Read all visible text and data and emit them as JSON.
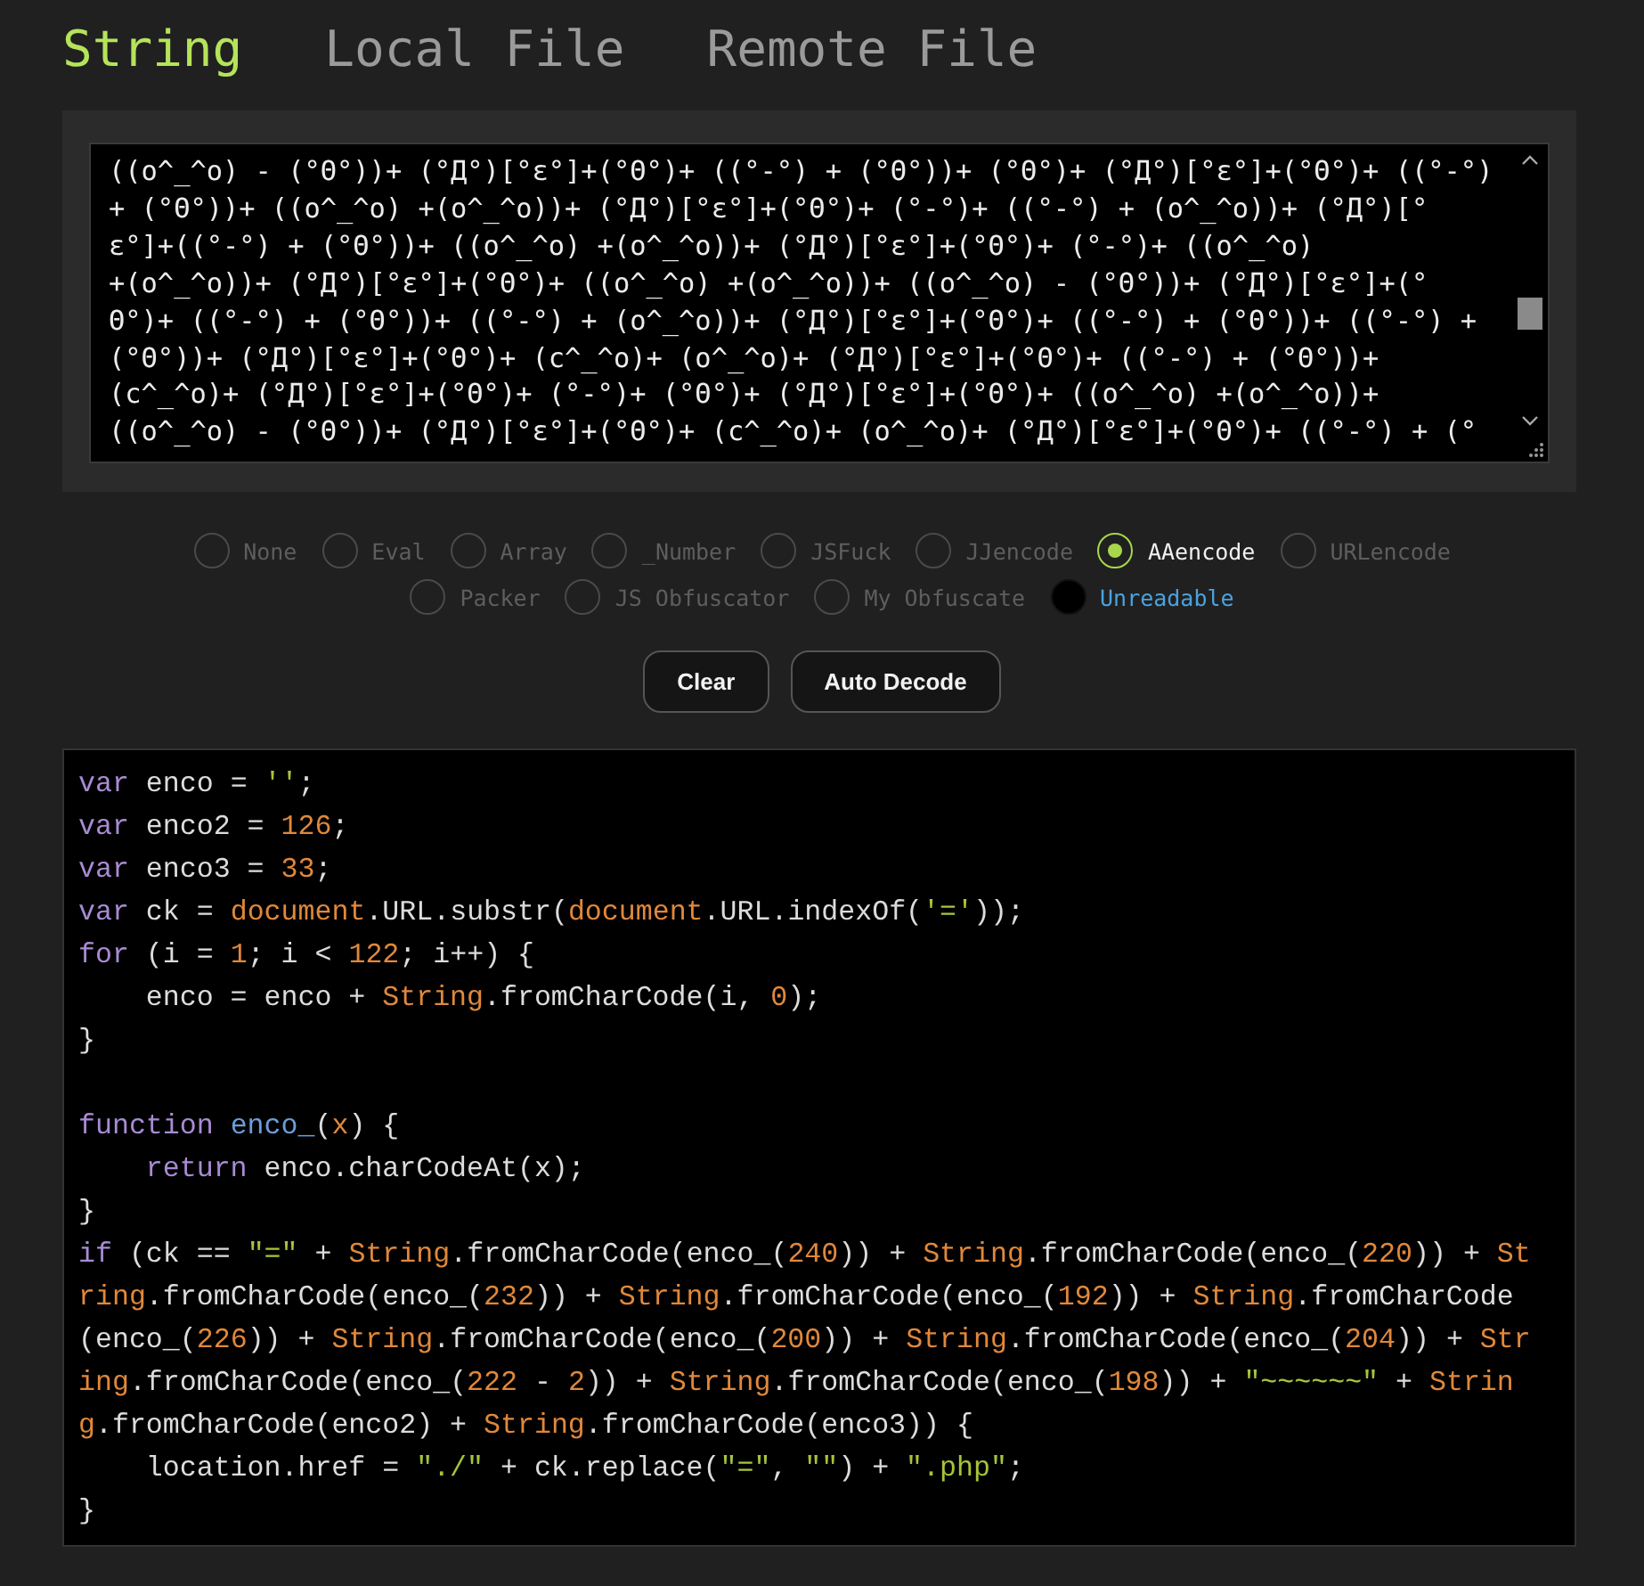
{
  "tabs": [
    {
      "label": "String",
      "selected": true
    },
    {
      "label": "Local File",
      "selected": false
    },
    {
      "label": "Remote File",
      "selected": false
    }
  ],
  "input": {
    "lines": [
      "((o^_^o) - (°Θ°))+ (°Д°)[°ε°]+(°Θ°)+ ((°-°) + (°Θ°))+ (°Θ°)+ (°Д°)[°ε°]+(°Θ°)+ ((°-°)",
      "+ (°Θ°))+ ((o^_^o) +(o^_^o))+ (°Д°)[°ε°]+(°Θ°)+ (°-°)+ ((°-°) + (o^_^o))+ (°Д°)[°",
      "ε°]+((°-°) + (°Θ°))+ ((o^_^o) +(o^_^o))+ (°Д°)[°ε°]+(°Θ°)+ (°-°)+ ((o^_^o)",
      "+(o^_^o))+ (°Д°)[°ε°]+(°Θ°)+ ((o^_^o) +(o^_^o))+ ((o^_^o) - (°Θ°))+ (°Д°)[°ε°]+(°",
      "Θ°)+ ((°-°) + (°Θ°))+ ((°-°) + (o^_^o))+ (°Д°)[°ε°]+(°Θ°)+ ((°-°) + (°Θ°))+ ((°-°) +",
      "(°Θ°))+ (°Д°)[°ε°]+(°Θ°)+ (c^_^o)+ (o^_^o)+ (°Д°)[°ε°]+(°Θ°)+ ((°-°) + (°Θ°))+",
      "(c^_^o)+ (°Д°)[°ε°]+(°Θ°)+ (°-°)+ (°Θ°)+ (°Д°)[°ε°]+(°Θ°)+ ((o^_^o) +(o^_^o))+",
      "((o^_^o) - (°Θ°))+ (°Д°)[°ε°]+(°Θ°)+ (c^_^o)+ (o^_^o)+ (°Д°)[°ε°]+(°Θ°)+ ((°-°) + (°"
    ]
  },
  "options": [
    [
      {
        "label": "None",
        "selected": false,
        "highlighted": false
      },
      {
        "label": "Eval",
        "selected": false,
        "highlighted": false
      },
      {
        "label": "Array",
        "selected": false,
        "highlighted": false
      },
      {
        "label": "_Number",
        "selected": false,
        "highlighted": false
      },
      {
        "label": "JSFuck",
        "selected": false,
        "highlighted": false
      },
      {
        "label": "JJencode",
        "selected": false,
        "highlighted": false
      },
      {
        "label": "AAencode",
        "selected": true,
        "highlighted": false
      },
      {
        "label": "URLencode",
        "selected": false,
        "highlighted": false
      }
    ],
    [
      {
        "label": "Packer",
        "selected": false,
        "highlighted": false
      },
      {
        "label": "JS Obfuscator",
        "selected": false,
        "highlighted": false
      },
      {
        "label": "My Obfuscate",
        "selected": false,
        "highlighted": false
      },
      {
        "label": "Unreadable",
        "selected": false,
        "highlighted": true
      }
    ]
  ],
  "buttons": [
    "Clear",
    "Auto Decode"
  ],
  "code": [
    {
      "kind": "code",
      "indented": false,
      "tokens": [
        {
          "kind": "kw",
          "text": "var"
        },
        {
          "kind": "p",
          "text": " enco = "
        },
        {
          "kind": "str",
          "text": "''"
        },
        {
          "kind": "p",
          "text": ";"
        }
      ]
    },
    {
      "kind": "code",
      "indented": false,
      "tokens": [
        {
          "kind": "kw",
          "text": "var"
        },
        {
          "kind": "p",
          "text": " enco2 = "
        },
        {
          "kind": "num",
          "text": "126"
        },
        {
          "kind": "p",
          "text": ";"
        }
      ]
    },
    {
      "kind": "code",
      "indented": false,
      "tokens": [
        {
          "kind": "kw",
          "text": "var"
        },
        {
          "kind": "p",
          "text": " enco3 = "
        },
        {
          "kind": "num",
          "text": "33"
        },
        {
          "kind": "p",
          "text": ";"
        }
      ]
    },
    {
      "kind": "code",
      "indented": false,
      "tokens": [
        {
          "kind": "kw",
          "text": "var"
        },
        {
          "kind": "p",
          "text": " ck = "
        },
        {
          "kind": "num",
          "text": "document"
        },
        {
          "kind": "p",
          "text": ".URL.substr("
        },
        {
          "kind": "num",
          "text": "document"
        },
        {
          "kind": "p",
          "text": ".URL.indexOf("
        },
        {
          "kind": "str",
          "text": "'='"
        },
        {
          "kind": "p",
          "text": "));"
        }
      ]
    },
    {
      "kind": "code",
      "indented": false,
      "tokens": [
        {
          "kind": "kw",
          "text": "for"
        },
        {
          "kind": "p",
          "text": " (i = "
        },
        {
          "kind": "num",
          "text": "1"
        },
        {
          "kind": "p",
          "text": "; i < "
        },
        {
          "kind": "num",
          "text": "122"
        },
        {
          "kind": "p",
          "text": "; i++) {"
        }
      ]
    },
    {
      "kind": "code",
      "indented": true,
      "tokens": [
        {
          "kind": "p",
          "text": "enco = enco + "
        },
        {
          "kind": "num",
          "text": "String"
        },
        {
          "kind": "p",
          "text": ".fromCharCode(i, "
        },
        {
          "kind": "num",
          "text": "0"
        },
        {
          "kind": "p",
          "text": ");"
        }
      ]
    },
    {
      "kind": "code",
      "indented": false,
      "tokens": [
        {
          "kind": "p",
          "text": "}"
        }
      ]
    },
    {
      "kind": "blank"
    },
    {
      "kind": "code",
      "indented": false,
      "tokens": [
        {
          "kind": "kw",
          "text": "function "
        },
        {
          "kind": "fn",
          "text": "enco_"
        },
        {
          "kind": "p",
          "text": "("
        },
        {
          "kind": "num",
          "text": "x"
        },
        {
          "kind": "p",
          "text": ") {"
        }
      ]
    },
    {
      "kind": "code",
      "indented": true,
      "tokens": [
        {
          "kind": "kw",
          "text": "return"
        },
        {
          "kind": "p",
          "text": " enco.charCodeAt(x);"
        }
      ]
    },
    {
      "kind": "code",
      "indented": false,
      "tokens": [
        {
          "kind": "p",
          "text": "}"
        }
      ]
    },
    {
      "kind": "code",
      "indented": false,
      "tokens": [
        {
          "kind": "kw",
          "text": "if"
        },
        {
          "kind": "p",
          "text": " (ck == "
        },
        {
          "kind": "str",
          "text": "\"=\""
        },
        {
          "kind": "p",
          "text": " + "
        },
        {
          "kind": "num",
          "text": "String"
        },
        {
          "kind": "p",
          "text": ".fromCharCode(enco_("
        },
        {
          "kind": "num",
          "text": "240"
        },
        {
          "kind": "p",
          "text": ")) + "
        },
        {
          "kind": "num",
          "text": "String"
        },
        {
          "kind": "p",
          "text": ".fromCharCode(enco_("
        },
        {
          "kind": "num",
          "text": "220"
        },
        {
          "kind": "p",
          "text": ")) + "
        },
        {
          "kind": "num",
          "text": "St"
        }
      ]
    },
    {
      "kind": "code",
      "indented": false,
      "tokens": [
        {
          "kind": "num",
          "text": "ring"
        },
        {
          "kind": "p",
          "text": ".fromCharCode(enco_("
        },
        {
          "kind": "num",
          "text": "232"
        },
        {
          "kind": "p",
          "text": ")) + "
        },
        {
          "kind": "num",
          "text": "String"
        },
        {
          "kind": "p",
          "text": ".fromCharCode(enco_("
        },
        {
          "kind": "num",
          "text": "192"
        },
        {
          "kind": "p",
          "text": ")) + "
        },
        {
          "kind": "num",
          "text": "String"
        },
        {
          "kind": "p",
          "text": ".fromCharCode"
        }
      ]
    },
    {
      "kind": "code",
      "indented": false,
      "tokens": [
        {
          "kind": "p",
          "text": "(enco_("
        },
        {
          "kind": "num",
          "text": "226"
        },
        {
          "kind": "p",
          "text": ")) + "
        },
        {
          "kind": "num",
          "text": "String"
        },
        {
          "kind": "p",
          "text": ".fromCharCode(enco_("
        },
        {
          "kind": "num",
          "text": "200"
        },
        {
          "kind": "p",
          "text": ")) + "
        },
        {
          "kind": "num",
          "text": "String"
        },
        {
          "kind": "p",
          "text": ".fromCharCode(enco_("
        },
        {
          "kind": "num",
          "text": "204"
        },
        {
          "kind": "p",
          "text": ")) + "
        },
        {
          "kind": "num",
          "text": "Str"
        }
      ]
    },
    {
      "kind": "code",
      "indented": false,
      "tokens": [
        {
          "kind": "num",
          "text": "ing"
        },
        {
          "kind": "p",
          "text": ".fromCharCode(enco_("
        },
        {
          "kind": "num",
          "text": "222"
        },
        {
          "kind": "p",
          "text": " - "
        },
        {
          "kind": "num",
          "text": "2"
        },
        {
          "kind": "p",
          "text": ")) + "
        },
        {
          "kind": "num",
          "text": "String"
        },
        {
          "kind": "p",
          "text": ".fromCharCode(enco_("
        },
        {
          "kind": "num",
          "text": "198"
        },
        {
          "kind": "p",
          "text": ")) + "
        },
        {
          "kind": "str",
          "text": "\"~~~~~~\""
        },
        {
          "kind": "p",
          "text": " + "
        },
        {
          "kind": "num",
          "text": "Strin"
        }
      ]
    },
    {
      "kind": "code",
      "indented": false,
      "tokens": [
        {
          "kind": "num",
          "text": "g"
        },
        {
          "kind": "p",
          "text": ".fromCharCode(enco2) + "
        },
        {
          "kind": "num",
          "text": "String"
        },
        {
          "kind": "p",
          "text": ".fromCharCode(enco3)) {"
        }
      ]
    },
    {
      "kind": "code",
      "indented": true,
      "tokens": [
        {
          "kind": "p",
          "text": "location.href = "
        },
        {
          "kind": "str",
          "text": "\"./\""
        },
        {
          "kind": "p",
          "text": " + ck.replace("
        },
        {
          "kind": "str",
          "text": "\"=\""
        },
        {
          "kind": "p",
          "text": ", "
        },
        {
          "kind": "str",
          "text": "\"\""
        },
        {
          "kind": "p",
          "text": ") + "
        },
        {
          "kind": "str",
          "text": "\".php\""
        },
        {
          "kind": "p",
          "text": ";"
        }
      ]
    },
    {
      "kind": "code",
      "indented": false,
      "tokens": [
        {
          "kind": "p",
          "text": "}"
        }
      ]
    }
  ]
}
